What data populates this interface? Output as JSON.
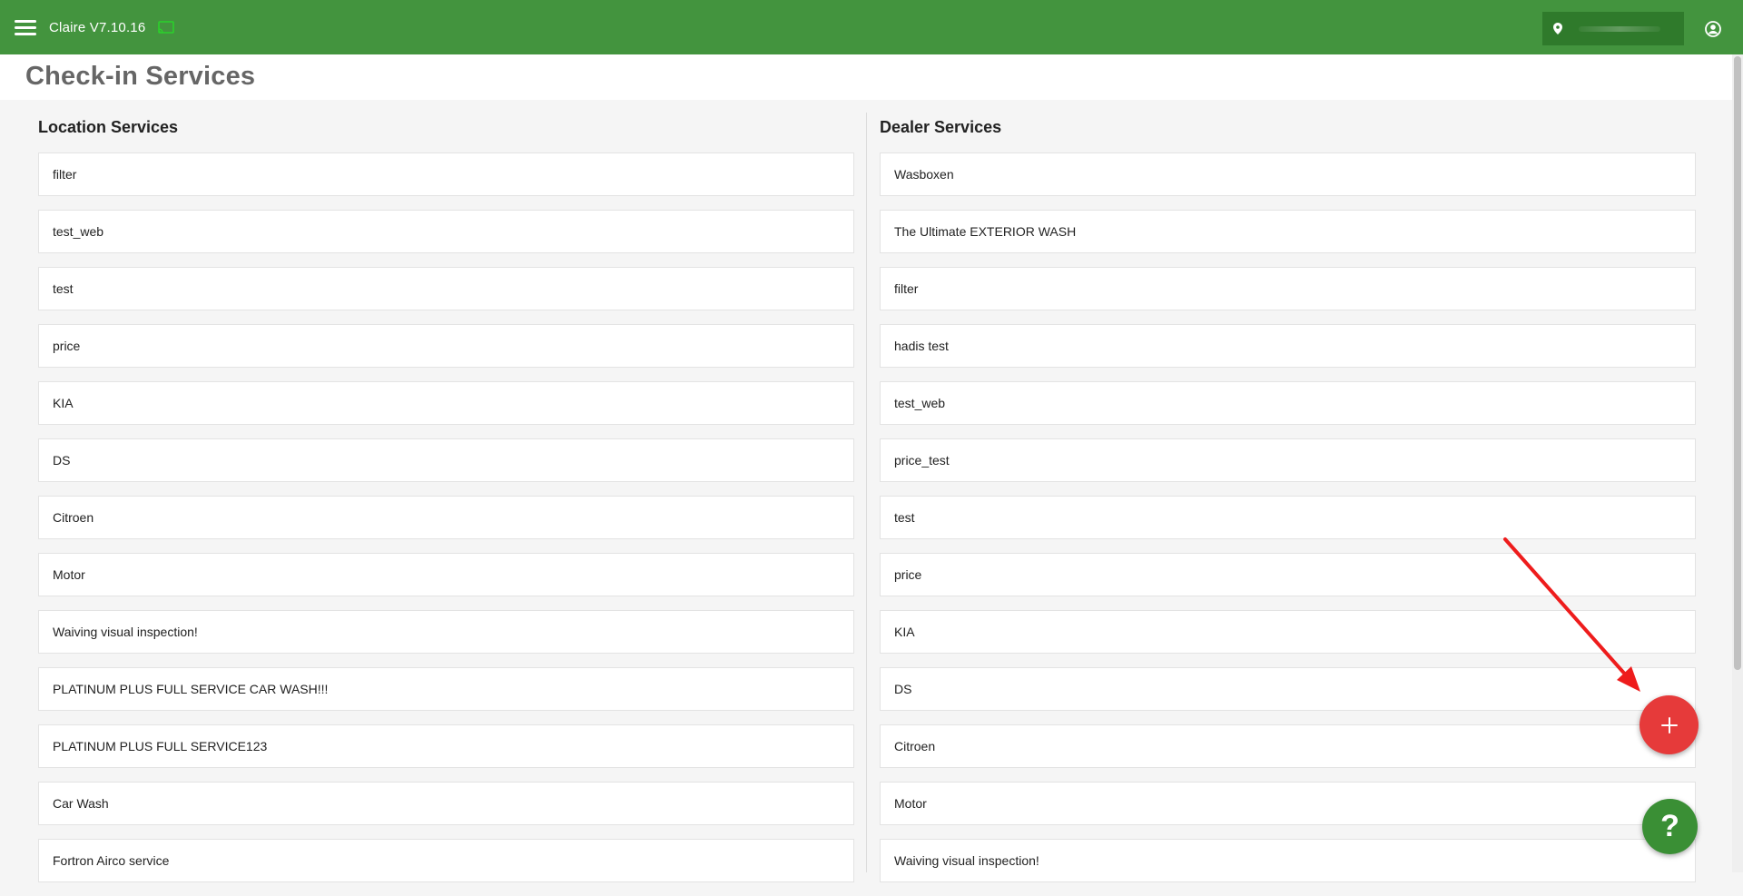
{
  "header": {
    "app_title": "Claire V7.10.16",
    "icons": [
      "menu-icon",
      "cast-icon",
      "location-pin-icon",
      "account-icon"
    ]
  },
  "page": {
    "title": "Check-in Services"
  },
  "location_services": {
    "title": "Location Services",
    "items": [
      "filter",
      "test_web",
      "test",
      "price",
      "KIA",
      "DS",
      "Citroen",
      "Motor",
      "Waiving visual inspection!",
      "PLATINUM PLUS FULL SERVICE CAR WASH!!!",
      "PLATINUM PLUS FULL SERVICE123",
      "Car Wash",
      "Fortron Airco service"
    ]
  },
  "dealer_services": {
    "title": "Dealer Services",
    "items": [
      "Wasboxen",
      "The Ultimate EXTERIOR WASH",
      "filter",
      "hadis test",
      "test_web",
      "price_test",
      "test",
      "price",
      "KIA",
      "DS",
      "Citroen",
      "Motor",
      "Waiving visual inspection!"
    ]
  },
  "fab": {
    "add_icon": "plus-icon",
    "help_label": "?"
  },
  "colors": {
    "header": "#43943e",
    "location_box": "#2f7a2b",
    "add_button": "#e63a3a",
    "help_button": "#3a8f35",
    "annotation_arrow": "#ee1c1c"
  }
}
